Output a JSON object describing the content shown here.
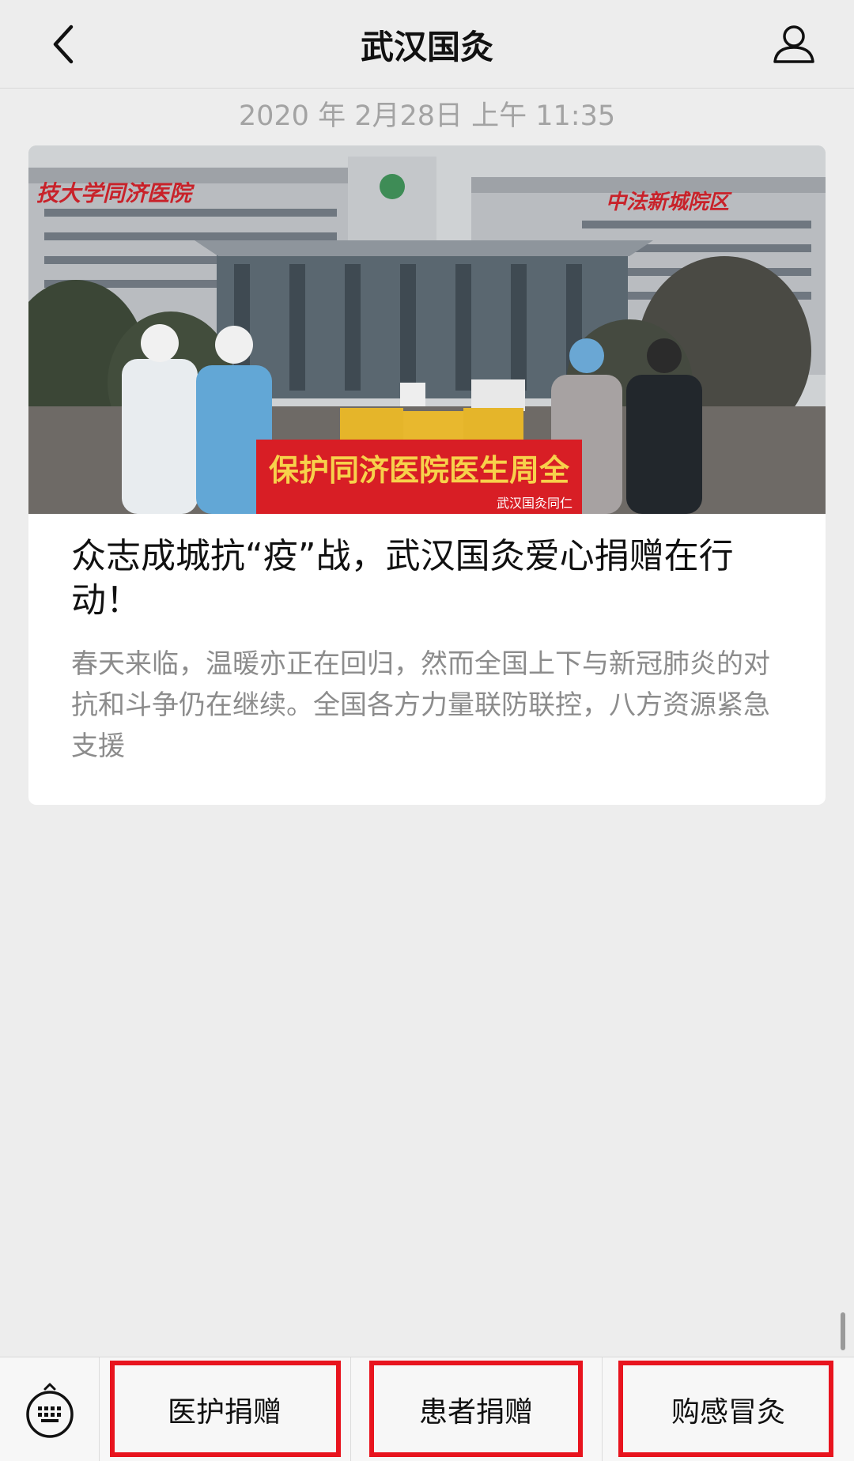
{
  "header": {
    "title": "武汉国灸",
    "back_icon": "chevron-left-icon",
    "profile_icon": "user-icon"
  },
  "message": {
    "timestamp": "2020 年 2月28日 上午 11:35",
    "image": {
      "banner_text": "保护同济医院医生周全",
      "banner_sub": "武汉国灸同仁",
      "building_sign_left": "技大学同济医院",
      "building_sign_right": "中法新城院区"
    },
    "title": "众志成城抗“疫”战，武汉国灸爱心捐赠在行动！",
    "description": "春天来临，温暖亦正在回归，然而全国上下与新冠肺炎的对抗和斗争仍在继续。全国各方力量联防联控，八方资源紧急支援"
  },
  "bottom_menu": {
    "keyboard_icon": "keyboard-icon",
    "items": [
      {
        "label": "医护捐赠"
      },
      {
        "label": "患者捐赠"
      },
      {
        "label": "购感冒灸"
      }
    ]
  },
  "colors": {
    "background": "#ededed",
    "highlight": "#e8141e",
    "banner": "#d81e25"
  }
}
